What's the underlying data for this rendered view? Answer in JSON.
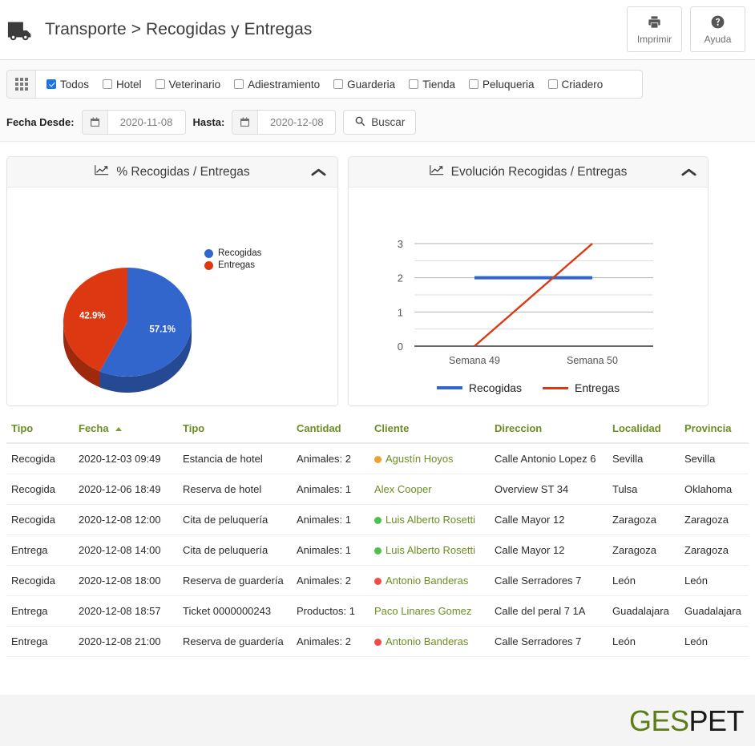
{
  "header": {
    "icon": "truck-icon",
    "title": "Transporte > Recogidas y Entregas",
    "actions": [
      {
        "icon": "printer-icon",
        "label": "Imprimir"
      },
      {
        "icon": "help-circle-icon",
        "label": "Ayuda"
      }
    ]
  },
  "filters": {
    "grid_icon": "grid-icon",
    "types": [
      {
        "label": "Todos",
        "checked": true
      },
      {
        "label": "Hotel",
        "checked": false
      },
      {
        "label": "Veterinario",
        "checked": false
      },
      {
        "label": "Adiestramiento",
        "checked": false
      },
      {
        "label": "Guarderia",
        "checked": false
      },
      {
        "label": "Tienda",
        "checked": false
      },
      {
        "label": "Peluqueria",
        "checked": false
      },
      {
        "label": "Criadero",
        "checked": false
      }
    ],
    "date_from_label": "Fecha Desde:",
    "date_from_value": "2020-11-08",
    "date_to_label": "Hasta:",
    "date_to_value": "2020-12-08",
    "search_label": "Buscar",
    "search_icon": "search-icon",
    "calendar_icon": "calendar-icon"
  },
  "panels": {
    "pie": {
      "title": "% Recogidas / Entregas",
      "icon": "line-chart-icon",
      "collapse_icon": "chevron-up-icon"
    },
    "line": {
      "title": "Evolución Recogidas / Entregas",
      "icon": "line-chart-icon",
      "collapse_icon": "chevron-up-icon"
    }
  },
  "chart_data": [
    {
      "type": "pie",
      "title": "% Recogidas / Entregas",
      "labels": [
        "Recogidas",
        "Entregas"
      ],
      "values": [
        57.1,
        42.9
      ],
      "value_labels": [
        "57.1%",
        "42.9%"
      ],
      "colors": [
        "#3366cc",
        "#dc3912"
      ],
      "legend_position": "right",
      "is3d": true
    },
    {
      "type": "line",
      "title": "Evolución Recogidas / Entregas",
      "categories": [
        "Semana 49",
        "Semana 50"
      ],
      "series": [
        {
          "name": "Recogidas",
          "values": [
            2,
            2
          ],
          "color": "#3366cc"
        },
        {
          "name": "Entregas",
          "values": [
            0,
            3
          ],
          "color": "#dc3912"
        }
      ],
      "ylim": [
        0,
        3
      ],
      "yticks": [
        0,
        1,
        2,
        3
      ],
      "ytick_labels": [
        "0",
        "1",
        "2",
        "3"
      ],
      "xlabel": "",
      "ylabel": "",
      "grid": true,
      "legend_position": "bottom"
    }
  ],
  "table": {
    "columns": [
      "Tipo",
      "Fecha",
      "Tipo",
      "Cantidad",
      "Cliente",
      "Direccion",
      "Localidad",
      "Provincia"
    ],
    "sorted_column_index": 1,
    "sort_direction": "asc",
    "rows": [
      {
        "tipo": "Recogida",
        "fecha": "2020-12-03 09:49",
        "tipo2": "Estancia de hotel",
        "cantidad": "Animales: 2",
        "cliente": "Agustín Hoyos",
        "dot": "#f0a030",
        "direccion": "Calle Antonio Lopez 6",
        "localidad": "Sevilla",
        "provincia": "Sevilla"
      },
      {
        "tipo": "Recogida",
        "fecha": "2020-12-06 18:49",
        "tipo2": "Reserva de hotel",
        "cantidad": "Animales: 1",
        "cliente": "Alex Cooper",
        "dot": "",
        "direccion": "Overview ST 34",
        "localidad": "Tulsa",
        "provincia": "Oklahoma"
      },
      {
        "tipo": "Recogida",
        "fecha": "2020-12-08 12:00",
        "tipo2": "Cita de peluquería",
        "cantidad": "Animales: 1",
        "cliente": "Luis Alberto Rosetti",
        "dot": "#4cc14c",
        "direccion": "Calle Mayor 12",
        "localidad": "Zaragoza",
        "provincia": "Zaragoza"
      },
      {
        "tipo": "Entrega",
        "fecha": "2020-12-08 14:00",
        "tipo2": "Cita de peluquería",
        "cantidad": "Animales: 1",
        "cliente": "Luis Alberto Rosetti",
        "dot": "#4cc14c",
        "direccion": "Calle Mayor 12",
        "localidad": "Zaragoza",
        "provincia": "Zaragoza"
      },
      {
        "tipo": "Recogida",
        "fecha": "2020-12-08 18:00",
        "tipo2": "Reserva de guardería",
        "cantidad": "Animales: 2",
        "cliente": "Antonio Banderas",
        "dot": "#ef4b4b",
        "direccion": "Calle Serradores 7",
        "localidad": "León",
        "provincia": "León"
      },
      {
        "tipo": "Entrega",
        "fecha": "2020-12-08 18:57",
        "tipo2": "Ticket 0000000243",
        "cantidad": "Productos: 1",
        "cliente": "Paco Linares Gomez",
        "dot": "",
        "direccion": "Calle del peral 7 1A",
        "localidad": "Guadalajara",
        "provincia": "Guadalajara"
      },
      {
        "tipo": "Entrega",
        "fecha": "2020-12-08 21:00",
        "tipo2": "Reserva de guardería",
        "cantidad": "Animales: 2",
        "cliente": "Antonio Banderas",
        "dot": "#ef4b4b",
        "direccion": "Calle Serradores 7",
        "localidad": "León",
        "provincia": "León"
      }
    ]
  },
  "footer": {
    "logo_part1": "GES",
    "logo_part2": "PET",
    "logo_color1": "#5d7c1a",
    "logo_color2": "#1a1a1a"
  }
}
